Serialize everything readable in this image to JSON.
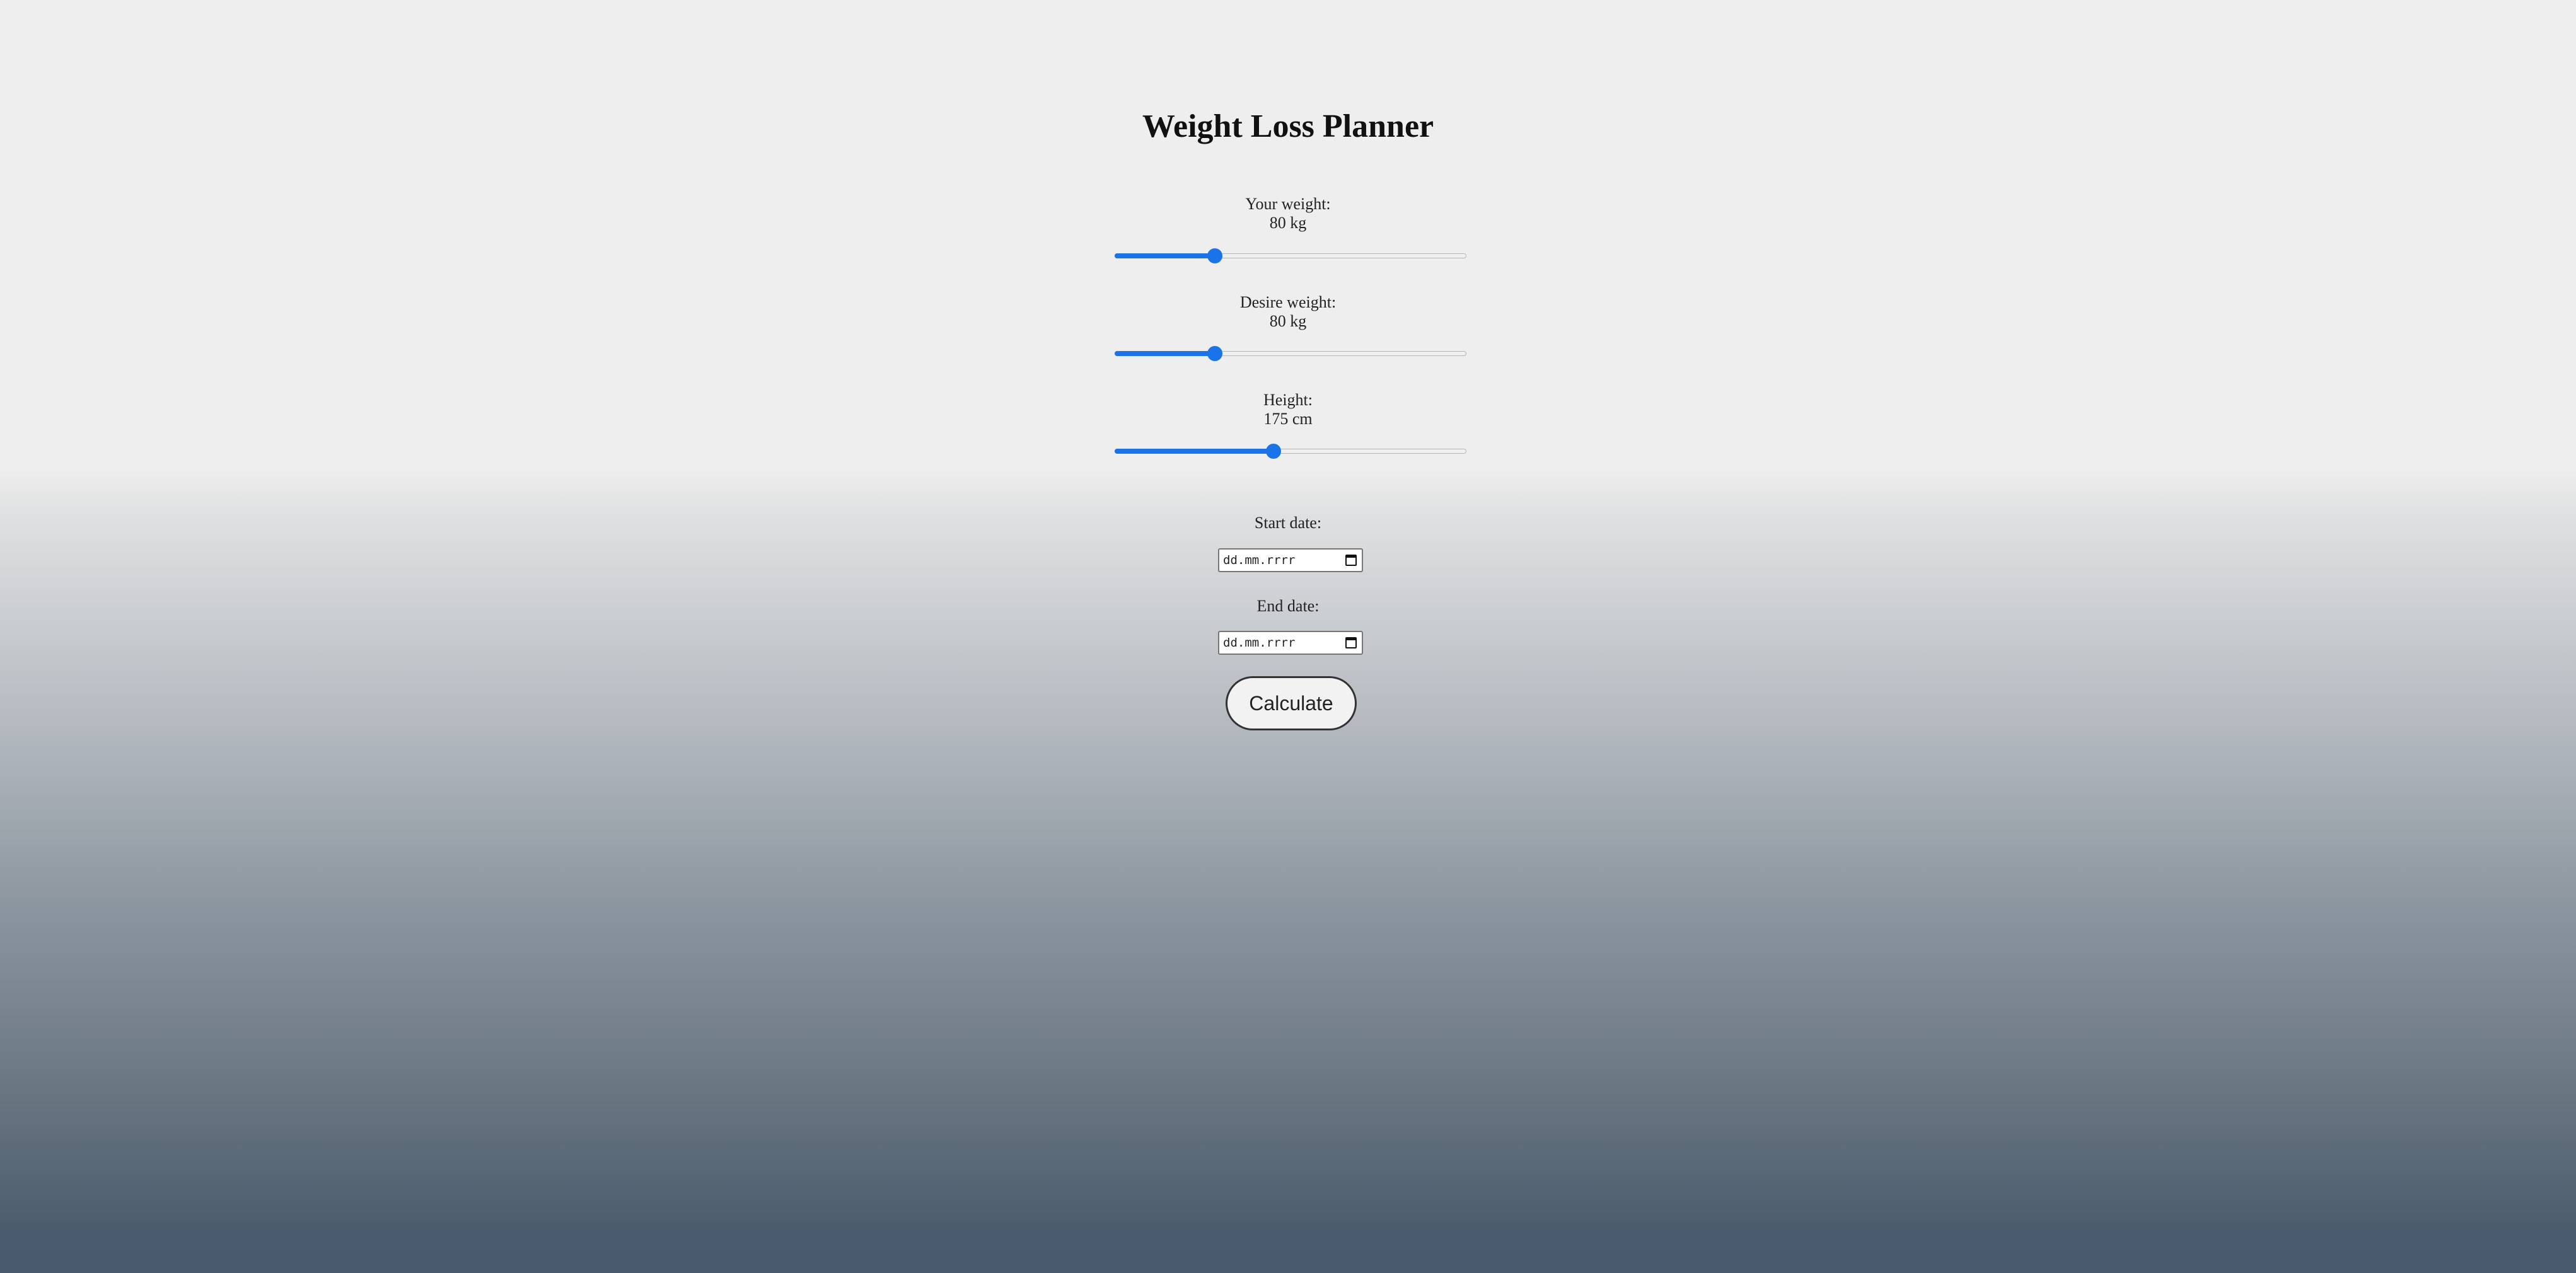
{
  "page": {
    "title": "Weight Loss Planner"
  },
  "sliders": {
    "your_weight": {
      "label": "Your weight:",
      "value_text": "80 kg",
      "fill_fraction": 0.285
    },
    "desire_weight": {
      "label": "Desire weight:",
      "value_text": "80 kg",
      "fill_fraction": 0.285
    },
    "height": {
      "label": "Height:",
      "value_text": "175 cm",
      "fill_fraction": 0.452
    }
  },
  "dates": {
    "start": {
      "label": "Start date:",
      "placeholder": "dd.mm.rrrr"
    },
    "end": {
      "label": "End date:",
      "placeholder": "dd.mm.rrrr"
    }
  },
  "actions": {
    "calculate_label": "Calculate"
  },
  "colors": {
    "accent": "#1a73e8",
    "background_top": "#eeeeee",
    "background_bottom": "#485a6c"
  },
  "icons": {
    "date_picker": "calendar-icon"
  }
}
